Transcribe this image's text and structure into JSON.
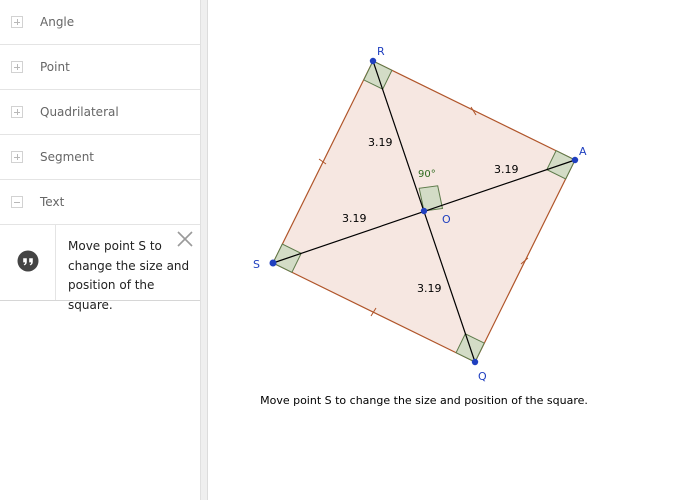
{
  "algebra_view": {
    "categories": [
      {
        "label": "Angle",
        "state": "collapsed"
      },
      {
        "label": "Point",
        "state": "collapsed"
      },
      {
        "label": "Quadrilateral",
        "state": "collapsed"
      },
      {
        "label": "Segment",
        "state": "collapsed"
      },
      {
        "label": "Text",
        "state": "expanded"
      }
    ],
    "text_item": {
      "lines": [
        "Move point S to",
        "change the size and",
        "position of the square."
      ],
      "icon": "quote-marker-icon",
      "close_icon": "close-icon"
    }
  },
  "graphics_view": {
    "points": {
      "R": "R",
      "A": "A",
      "S": "S",
      "Q": "Q",
      "O": "O"
    },
    "distances": {
      "OR": "3.19",
      "OA": "3.19",
      "OS": "3.19",
      "OQ": "3.19"
    },
    "angle_label": "90°",
    "caption": "Move point S to change the size and position of the square."
  },
  "colors": {
    "square_fill": "#f5e3dc",
    "square_edge": "#b0552a",
    "right_angle_fill": "#d3dcc6",
    "right_angle_edge": "#5d7a4a",
    "angle_label": "#2f6b1f",
    "point": "#1f3fbf",
    "point_label": "#1f3fbf",
    "diagonal": "#000000"
  }
}
